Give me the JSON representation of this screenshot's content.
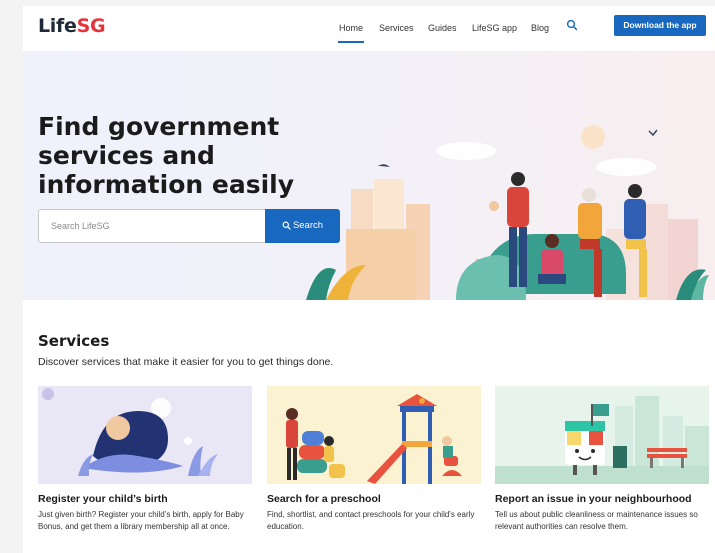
{
  "header": {
    "logo_part1": "Life",
    "logo_part2": "SG",
    "nav": [
      "Home",
      "Services",
      "Guides",
      "LifeSG app",
      "Blog"
    ],
    "active_nav": "Home",
    "download_label": "Download the app"
  },
  "hero": {
    "title": "Find government services and information easily",
    "search_placeholder": "Search LifeSG",
    "search_button": "Search"
  },
  "services": {
    "title": "Services",
    "subtitle": "Discover services that make it easier for you to get things done.",
    "cards": [
      {
        "title": "Register your child’s birth",
        "description": "Just given birth? Register your child’s birth, apply for Baby Bonus, and get them a library membership all at once."
      },
      {
        "title": "Search for a preschool",
        "description": "Find, shortlist, and contact preschools for your child's early education."
      },
      {
        "title": "Report an issue in your neighbourhood",
        "description": "Tell us about public cleanliness or maintenance issues so relevant authorities can resolve them."
      }
    ]
  },
  "colors": {
    "brand_blue": "#1768be",
    "logo_red": "#e8333c"
  },
  "icons": [
    "search-icon"
  ]
}
